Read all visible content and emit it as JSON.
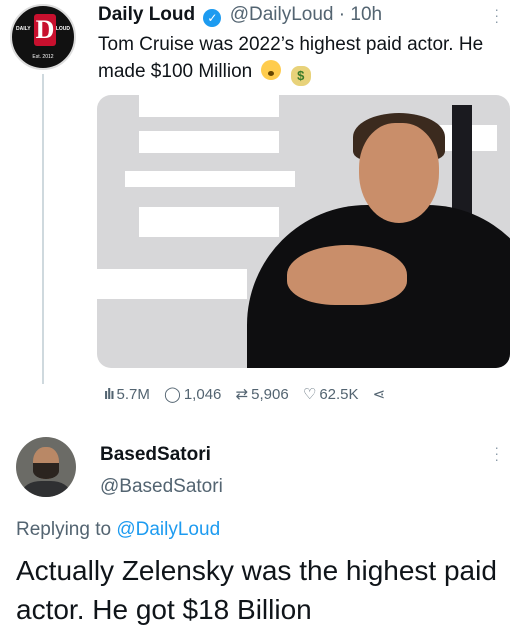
{
  "original_tweet": {
    "display_name": "Daily Loud",
    "verified": true,
    "handle": "@DailyLoud",
    "separator": "·",
    "time": "10h",
    "text": "Tom Cruise was 2022’s highest paid actor. He made $100 Million",
    "emojis": [
      "shocked-face-emoji",
      "money-bag-emoji"
    ],
    "avatar": {
      "logo_letter": "DL",
      "left_text": "DAILY",
      "right_text": "LOUD",
      "est_text": "Est. 2012"
    },
    "stats": {
      "views": "5.7M",
      "replies": "1,046",
      "retweets": "5,906",
      "likes": "62.5K"
    }
  },
  "reply_tweet": {
    "display_name": "BasedSatori",
    "handle": "@BasedSatori",
    "replying_prefix": "Replying to",
    "replying_to": "@DailyLoud",
    "text": "Actually Zelensky was the highest paid actor. He got $18 Billion"
  },
  "icons": {
    "more": "more-options-icon",
    "views": "views-bar-icon",
    "reply": "reply-icon",
    "retweet": "retweet-icon",
    "like": "heart-icon",
    "share": "share-icon"
  },
  "colors": {
    "accent": "#1d9bf0",
    "secondary_text": "#536471",
    "primary_text": "#0f1419"
  }
}
